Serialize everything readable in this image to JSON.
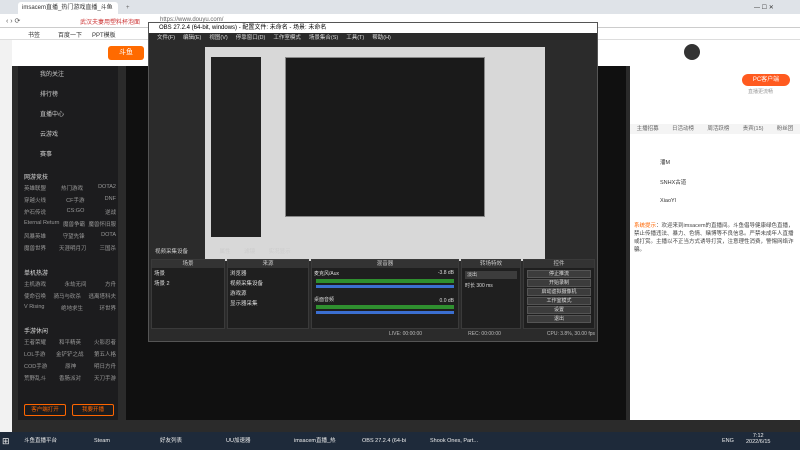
{
  "browser": {
    "tab_title": "imsacem直播_热门游戏直播_斗鱼",
    "address": "https://www.douyu.com/",
    "bookmarks": [
      "书签",
      "百度一下",
      "PPT模板"
    ]
  },
  "site": {
    "notice": "武汉夫妻用塑料杯泡面"
  },
  "sidebar": {
    "items": [
      "我的关注",
      "排行榜",
      "直播中心",
      "云游戏",
      "赛事"
    ],
    "sections": [
      {
        "title": "网游竞技",
        "rows": [
          [
            "英雄联盟",
            "热门游戏",
            "DOTA2"
          ],
          [
            "穿越火线",
            "CF手游",
            "DNF"
          ],
          [
            "炉石传说",
            "CS:GO",
            "逆战"
          ],
          [
            "Eternal Return",
            "魔兽争霸",
            "魔兽怀旧服"
          ],
          [
            "风暴英雄",
            "守望先锋",
            "DOTA"
          ],
          [
            "魔兽世界",
            "天涯明月刀",
            "三国杀"
          ]
        ]
      },
      {
        "title": "单机热游",
        "rows": [
          [
            "主机游戏",
            "永劫无间",
            "方舟"
          ],
          [
            "使命召唤",
            "骑马与砍杀",
            "逃离塔科夫"
          ],
          [
            "V Rising",
            "绝地求生",
            "环世界"
          ]
        ]
      },
      {
        "title": "手游休闲",
        "rows": [
          [
            "王者荣耀",
            "和平精英",
            "火影忍者"
          ],
          [
            "LOL手游",
            "金铲铲之战",
            "第五人格"
          ],
          [
            "COD手游",
            "原神",
            "明日方舟"
          ],
          [
            "荒野乱斗",
            "香肠派对",
            "天刀手游"
          ]
        ]
      }
    ],
    "btn_download": "客户端打开",
    "btn_start": "我要开播"
  },
  "obs": {
    "title": "OBS 27.2.4 (64-bit, windows) - 配置文件: 未命名 - 场景: 未命名",
    "menu": [
      "文件(F)",
      "编辑(E)",
      "视图(V)",
      "停靠窗口(D)",
      "工作室模式",
      "场景集合(S)",
      "工具(T)",
      "帮助(H)"
    ],
    "source_bar": [
      "视频采集设备",
      "属性",
      "滤镜",
      "实况显示"
    ],
    "headers": {
      "scenes": "场景",
      "sources": "来源",
      "mixer": "混音器",
      "transitions": "转场特效",
      "controls": "控件"
    },
    "scenes": [
      "场景",
      "场景 2"
    ],
    "sources": [
      "浏览器",
      "视频采集设备",
      "游戏源",
      "显示器采集"
    ],
    "mixer": [
      {
        "name": "麦克风/Aux",
        "db": "-3.8 dB"
      },
      {
        "name": "桌面音频",
        "db": "0.0 dB"
      }
    ],
    "transition": {
      "type": "淡出",
      "duration_label": "时长",
      "duration": "300 ms"
    },
    "controls": [
      "停止推流",
      "开始录制",
      "启动虚拟摄像机",
      "工作室模式",
      "设置",
      "退出"
    ],
    "status": [
      "LIVE: 00:00:00",
      "REC: 00:00:00",
      "CPU: 3.8%, 30.00 fps"
    ]
  },
  "right": {
    "tabs": [
      "主播招募",
      "日活动榜",
      "周活跃榜",
      "贵宾(15)",
      "粉丝团"
    ],
    "ranks": [
      "潘M",
      "SNHX古道",
      "XiaoYl"
    ],
    "system_label": "系统提示",
    "system_msg": "欢迎来到imsacem的直播间。斗鱼倡导健康绿色直播，禁止传播违法、暴力、色情、赌博等不良信息。严禁未成年人直播或打赏。主播以不正当方式诱导打赏，注意理性消费，警惕网络诈骗。",
    "pc_btn": "PC客户端",
    "pc_sub": "直播更流畅"
  },
  "taskbar": {
    "items": [
      "斗鱼直播平台",
      "Steam",
      "好友列表",
      "UU加速器",
      "imsacem直播_热",
      "OBS 27.2.4 (64-bi",
      "Shook Ones, Part..."
    ],
    "lang": "ENG",
    "time": "7:12",
    "date": "2022/6/15"
  }
}
